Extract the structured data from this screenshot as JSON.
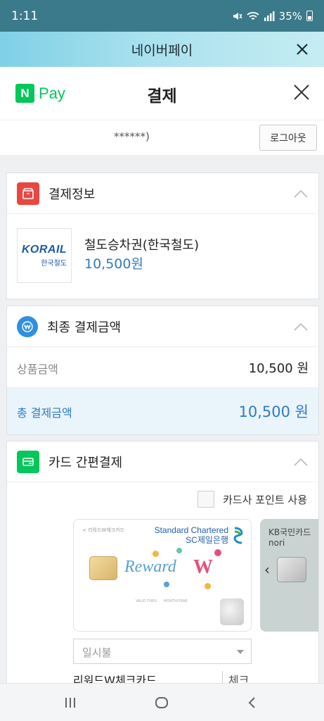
{
  "status_bar": {
    "time": "1:11",
    "battery": "35%"
  },
  "title_bar": {
    "title": "네이버페이"
  },
  "header": {
    "brand_n": "N",
    "brand_pay": "Pay",
    "title": "결제"
  },
  "user": {
    "masked_id": "******)",
    "logout_label": "로그아웃"
  },
  "payment_info": {
    "section_label": "결제정보",
    "logo_text": "KORAIL",
    "logo_subtext": "한국철도",
    "product_name": "철도승차권(한국철도)",
    "product_price": "10,500원"
  },
  "final_amount": {
    "section_label": "최종 결제금액",
    "product_amount_label": "상품금액",
    "product_amount_value": "10,500 원",
    "total_label": "총 결제금액",
    "total_value": "10,500 원"
  },
  "card_payment": {
    "section_label": "카드 간편결제",
    "point_checkbox_label": "카드사 포인트 사용",
    "card1": {
      "small_label": "< 리워드W체크카드",
      "issuer_line1": "Standard Chartered",
      "issuer_line2": "SC제일은행",
      "design_text": "Reward",
      "design_mark": "W",
      "mini_left": "VALID THRU",
      "mini_mid": "MONTH/YEAR"
    },
    "card2": {
      "issuer": "KB국민카드",
      "name": "nori",
      "arrow": "‹"
    },
    "installment_value": "일시불",
    "card_name": "리워드W체크카드 ...",
    "card_type": "체크"
  },
  "colors": {
    "npay_green": "#03c75a",
    "accent_blue": "#2e7bc4",
    "info_red": "#e8473f",
    "total_blue": "#2f8fe0"
  }
}
